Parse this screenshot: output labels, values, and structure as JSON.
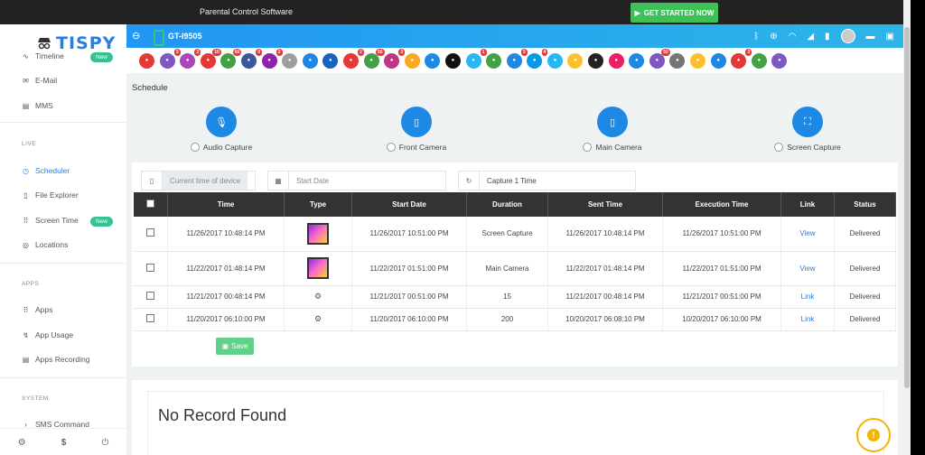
{
  "topbar": {
    "title": "Parental Control Software",
    "cta": "GET STARTED NOW"
  },
  "sidebar": {
    "logo": "TISPY",
    "items_top": [
      {
        "label": "Timeline",
        "badge": "New"
      },
      {
        "label": "E-Mail"
      },
      {
        "label": "MMS"
      }
    ],
    "section_live": "LIVE",
    "items_live": [
      {
        "label": "Scheduler"
      },
      {
        "label": "File Explorer"
      },
      {
        "label": "Screen Time",
        "badge": "New"
      },
      {
        "label": "Locations"
      }
    ],
    "section_apps": "APPS",
    "items_apps": [
      {
        "label": "Apps"
      },
      {
        "label": "App Usage"
      },
      {
        "label": "Apps Recording"
      }
    ],
    "section_system": "SYSTEM",
    "items_system": [
      {
        "label": "SMS Command"
      }
    ],
    "footer": {
      "dollar": "$"
    }
  },
  "device": {
    "name": "GT-I9505"
  },
  "apps": [
    {
      "icon": "camera-icon",
      "color": "#e53935",
      "count": ""
    },
    {
      "icon": "phone-icon",
      "color": "#7e57c2",
      "count": "3"
    },
    {
      "icon": "message-icon",
      "color": "#ab47bc",
      "count": "3"
    },
    {
      "icon": "gallery-icon",
      "color": "#e53935",
      "count": "10"
    },
    {
      "icon": "whatsapp-icon",
      "color": "#43a047",
      "count": "66"
    },
    {
      "icon": "facebook-icon",
      "color": "#3b5998",
      "count": "9"
    },
    {
      "icon": "viber-icon",
      "color": "#8e24aa",
      "count": "2"
    },
    {
      "icon": "clipboard-icon",
      "color": "#9e9e9e",
      "count": ""
    },
    {
      "icon": "screen-icon",
      "color": "#1e88e5",
      "count": ""
    },
    {
      "icon": "browser-icon",
      "color": "#1565c0",
      "count": ""
    },
    {
      "icon": "tinder-icon",
      "color": "#e53935",
      "count": "2"
    },
    {
      "icon": "wechat-icon",
      "color": "#43a047",
      "count": "55"
    },
    {
      "icon": "instagram-icon",
      "color": "#c13584",
      "count": "3"
    },
    {
      "icon": "snapchat-icon",
      "color": "#f9a825",
      "count": ""
    },
    {
      "icon": "flickr-icon",
      "color": "#1e88e5",
      "count": ""
    },
    {
      "icon": "tiktok-icon",
      "color": "#111111",
      "count": ""
    },
    {
      "icon": "telegram-icon",
      "color": "#29b6f6",
      "count": "1"
    },
    {
      "icon": "line-icon",
      "color": "#43a047",
      "count": ""
    },
    {
      "icon": "messenger-icon",
      "color": "#1e88e5",
      "count": "3"
    },
    {
      "icon": "skype-icon",
      "color": "#039be5",
      "count": "4"
    },
    {
      "icon": "bip-icon",
      "color": "#29b6f6",
      "count": ""
    },
    {
      "icon": "hangouts-icon",
      "color": "#fbc02d",
      "count": ""
    },
    {
      "icon": "kik-icon",
      "color": "#222222",
      "count": ""
    },
    {
      "icon": "video-icon",
      "color": "#e91e63",
      "count": ""
    },
    {
      "icon": "signal-icon",
      "color": "#1e88e5",
      "count": ""
    },
    {
      "icon": "imo-icon",
      "color": "#7e57c2",
      "count": "50"
    },
    {
      "icon": "hike-icon",
      "color": "#757575",
      "count": ""
    },
    {
      "icon": "files-icon",
      "color": "#fbc02d",
      "count": ""
    },
    {
      "icon": "device-icon",
      "color": "#1e88e5",
      "count": ""
    },
    {
      "icon": "web-icon",
      "color": "#e53935",
      "count": "3"
    },
    {
      "icon": "download-icon",
      "color": "#43a047",
      "count": ""
    },
    {
      "icon": "location-pin-icon",
      "color": "#7e57c2",
      "count": ""
    }
  ],
  "schedule": {
    "title": "Schedule",
    "captures": [
      "Audio Capture",
      "Front Camera",
      "Main Camera",
      "Screen Capture"
    ],
    "fields": {
      "device_time": "Current time of device",
      "start_date": "Start Date",
      "capture": "Capture 1 Time"
    },
    "columns": [
      "Time",
      "Type",
      "Start Date",
      "Duration",
      "Sent Time",
      "Execution Time",
      "Link",
      "Status"
    ],
    "rows": [
      {
        "time": "11/26/2017 10:48:14 PM",
        "type": "image",
        "start": "11/26/2017 10:51:00 PM",
        "duration": "Screen Capture",
        "sent": "11/26/2017 10:48:14 PM",
        "exec": "11/26/2017 10:51:00 PM",
        "link": "View",
        "status": "Delivered"
      },
      {
        "time": "11/22/2017 01:48:14 PM",
        "type": "image",
        "start": "11/22/2017 01:51:00 PM",
        "duration": "Main Camera",
        "sent": "11/22/2017 01:48:14 PM",
        "exec": "11/22/2017 01:51:00 PM",
        "link": "View",
        "status": "Delivered"
      },
      {
        "time": "11/21/2017 00:48:14 PM",
        "type": "gear",
        "start": "11/21/2017 00:51:00 PM",
        "duration": "15",
        "sent": "11/21/2017 00:48:14 PM",
        "exec": "11/21/2017 00:51:00 PM",
        "link": "Link",
        "status": "Delivered"
      },
      {
        "time": "11/20/2017 06:10:00 PM",
        "type": "gear",
        "start": "11/20/2017 06:10:00 PM",
        "duration": "200",
        "sent": "10/20/2017 06:08:10 PM",
        "exec": "10/20/2017 06:10:00 PM",
        "link": "Link",
        "status": "Delivered"
      }
    ],
    "save": "Save"
  },
  "records": {
    "message": "No Record Found"
  }
}
